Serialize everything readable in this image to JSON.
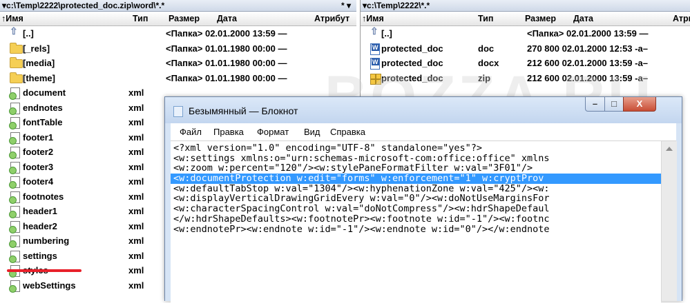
{
  "left_panel": {
    "path": "▾c:\\Temp\\2222\\protected_doc.zip\\word\\*.*",
    "path_controls": "*  ▾",
    "columns": {
      "name": "↑Имя",
      "type": "Тип",
      "size": "Размер",
      "date": "Дата",
      "attr": "Атрибут"
    },
    "rows": [
      {
        "icon": "up-icon",
        "name": "[..]",
        "type": "",
        "info": "<Папка> 02.01.2000 13:59 —"
      },
      {
        "icon": "folder-icon",
        "name": "[_rels]",
        "type": "",
        "info": "<Папка> 01.01.1980 00:00 —"
      },
      {
        "icon": "folder-icon",
        "name": "[media]",
        "type": "",
        "info": "<Папка> 01.01.1980 00:00 —"
      },
      {
        "icon": "folder-icon",
        "name": "[theme]",
        "type": "",
        "info": "<Папка> 01.01.1980 00:00 —"
      },
      {
        "icon": "xml-file-icon",
        "name": "document",
        "type": "xml",
        "info": ""
      },
      {
        "icon": "xml-file-icon",
        "name": "endnotes",
        "type": "xml",
        "info": ""
      },
      {
        "icon": "xml-file-icon",
        "name": "fontTable",
        "type": "xml",
        "info": ""
      },
      {
        "icon": "xml-file-icon",
        "name": "footer1",
        "type": "xml",
        "info": ""
      },
      {
        "icon": "xml-file-icon",
        "name": "footer2",
        "type": "xml",
        "info": ""
      },
      {
        "icon": "xml-file-icon",
        "name": "footer3",
        "type": "xml",
        "info": ""
      },
      {
        "icon": "xml-file-icon",
        "name": "footer4",
        "type": "xml",
        "info": ""
      },
      {
        "icon": "xml-file-icon",
        "name": "footnotes",
        "type": "xml",
        "info": ""
      },
      {
        "icon": "xml-file-icon",
        "name": "header1",
        "type": "xml",
        "info": ""
      },
      {
        "icon": "xml-file-icon",
        "name": "header2",
        "type": "xml",
        "info": ""
      },
      {
        "icon": "xml-file-icon",
        "name": "numbering",
        "type": "xml",
        "info": ""
      },
      {
        "icon": "xml-file-icon",
        "name": "settings",
        "type": "xml",
        "info": ""
      },
      {
        "icon": "xml-file-icon",
        "name": "styles",
        "type": "xml",
        "info": ""
      },
      {
        "icon": "xml-file-icon",
        "name": "webSettings",
        "type": "xml",
        "info": ""
      }
    ]
  },
  "right_panel": {
    "path": "▾c:\\Temp\\2222\\*.*",
    "columns": {
      "name": "↑Имя",
      "type": "Тип",
      "size": "Размер",
      "date": "Дата",
      "attr": "Атри"
    },
    "rows": [
      {
        "icon": "up-icon",
        "name": "[..]",
        "type": "",
        "info": "<Папка> 02.01.2000 13:59 —"
      },
      {
        "icon": "word-doc-icon",
        "name": "protected_doc",
        "type": "doc",
        "info": "270 800 02.01.2000 12:53 -a–"
      },
      {
        "icon": "word-docx-icon",
        "name": "protected_doc",
        "type": "docx",
        "info": "212 600 02.01.2000 13:59 -a–"
      },
      {
        "icon": "zip-archive-icon",
        "name": "protected_doc",
        "type": "zip",
        "info": "212 600 02.01.2000 13:59 -a–"
      }
    ]
  },
  "watermark": "BOZZA.RU",
  "notepad": {
    "title": "Безымянный — Блокнот",
    "controls": {
      "minimize": "–",
      "maximize": "□",
      "close": "X"
    },
    "menu": [
      "Файл",
      "Правка",
      "Формат",
      "Вид",
      "Справка"
    ],
    "lines": [
      "<?xml version=\"1.0\" encoding=\"UTF-8\" standalone=\"yes\"?>",
      "<w:settings xmlns:o=\"urn:schemas-microsoft-com:office:office\" xmlns",
      "<w:zoom w:percent=\"120\"/><w:stylePaneFormatFilter w:val=\"3F01\"/>",
      "<w:documentProtection w:edit=\"forms\" w:enforcement=\"1\" w:cryptProv",
      "<w:defaultTabStop w:val=\"1304\"/><w:hyphenationZone w:val=\"425\"/><w:",
      "<w:displayVerticalDrawingGridEvery w:val=\"0\"/><w:doNotUseMarginsFor",
      "<w:characterSpacingControl w:val=\"doNotCompress\"/><w:hdrShapeDefaul",
      "</w:hdrShapeDefaults><w:footnotePr><w:footnote w:id=\"-1\"/><w:footnc",
      "<w:endnotePr><w:endnote w:id=\"-1\"/><w:endnote w:id=\"0\"/></w:endnote"
    ],
    "selected_line": 3
  },
  "colors": {
    "selection": "#3399ff",
    "underline": "#e8202a",
    "titlebar": "#c3d6ef"
  }
}
